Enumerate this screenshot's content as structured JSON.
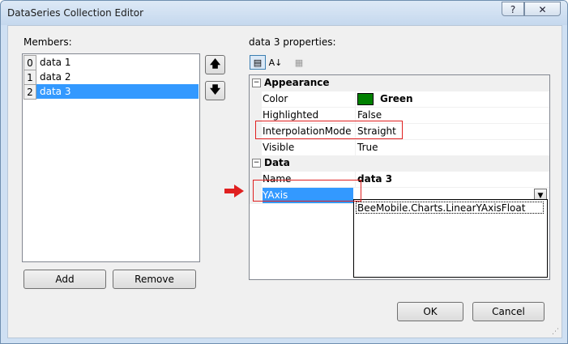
{
  "window": {
    "title": "DataSeries Collection Editor",
    "help_glyph": "?",
    "close_glyph": "✕"
  },
  "members": {
    "label": "Members:",
    "items": [
      {
        "index": "0",
        "name": "data 1"
      },
      {
        "index": "1",
        "name": "data 2"
      },
      {
        "index": "2",
        "name": "data 3"
      }
    ],
    "selected_index": 2,
    "up_glyph": "🡅",
    "down_glyph": "🡇",
    "add_label": "Add",
    "remove_label": "Remove"
  },
  "properties": {
    "label": "data 3 properties:",
    "toolbar": {
      "categorized_glyph": "▤",
      "alphabetical_glyph": "A↓",
      "pages_glyph": "▦"
    },
    "categories": [
      {
        "name": "Appearance",
        "expanded_glyph": "−"
      },
      {
        "name": "Data",
        "expanded_glyph": "−"
      }
    ],
    "appearance_rows": [
      {
        "name": "Color",
        "value": "Green"
      },
      {
        "name": "Highlighted",
        "value": "False"
      },
      {
        "name": "InterpolationMode",
        "value": "Straight"
      },
      {
        "name": "Visible",
        "value": "True"
      }
    ],
    "data_rows": [
      {
        "name": "Name",
        "value": "data 3"
      },
      {
        "name": "YAxis",
        "value": ""
      }
    ],
    "color_swatch": "#008000",
    "combo_glyph": "▼",
    "dropdown_items": [
      "BeeMobile.Charts.LinearYAxisFloat"
    ]
  },
  "footer": {
    "ok_label": "OK",
    "cancel_label": "Cancel"
  },
  "colors": {
    "selection": "#3399ff",
    "highlight_box": "#e02020",
    "title_bar": "#cfe0f3"
  }
}
